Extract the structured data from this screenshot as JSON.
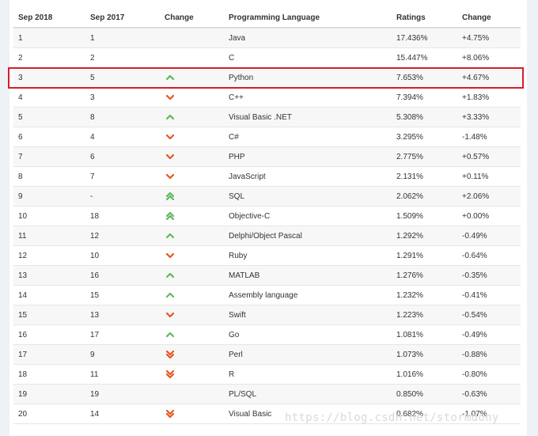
{
  "table": {
    "headers": [
      "Sep 2018",
      "Sep 2017",
      "Change",
      "Programming Language",
      "Ratings",
      "Change"
    ],
    "rows": [
      {
        "cur": "1",
        "prev": "1",
        "trend": "none",
        "lang": "Java",
        "rating": "17.436%",
        "change": "+4.75%"
      },
      {
        "cur": "2",
        "prev": "2",
        "trend": "none",
        "lang": "C",
        "rating": "15.447%",
        "change": "+8.06%"
      },
      {
        "cur": "3",
        "prev": "5",
        "trend": "up",
        "lang": "Python",
        "rating": "7.653%",
        "change": "+4.67%"
      },
      {
        "cur": "4",
        "prev": "3",
        "trend": "down",
        "lang": "C++",
        "rating": "7.394%",
        "change": "+1.83%"
      },
      {
        "cur": "5",
        "prev": "8",
        "trend": "up",
        "lang": "Visual Basic .NET",
        "rating": "5.308%",
        "change": "+3.33%"
      },
      {
        "cur": "6",
        "prev": "4",
        "trend": "down",
        "lang": "C#",
        "rating": "3.295%",
        "change": "-1.48%"
      },
      {
        "cur": "7",
        "prev": "6",
        "trend": "down",
        "lang": "PHP",
        "rating": "2.775%",
        "change": "+0.57%"
      },
      {
        "cur": "8",
        "prev": "7",
        "trend": "down",
        "lang": "JavaScript",
        "rating": "2.131%",
        "change": "+0.11%"
      },
      {
        "cur": "9",
        "prev": "-",
        "trend": "up2",
        "lang": "SQL",
        "rating": "2.062%",
        "change": "+2.06%"
      },
      {
        "cur": "10",
        "prev": "18",
        "trend": "up2",
        "lang": "Objective-C",
        "rating": "1.509%",
        "change": "+0.00%"
      },
      {
        "cur": "11",
        "prev": "12",
        "trend": "up",
        "lang": "Delphi/Object Pascal",
        "rating": "1.292%",
        "change": "-0.49%"
      },
      {
        "cur": "12",
        "prev": "10",
        "trend": "down",
        "lang": "Ruby",
        "rating": "1.291%",
        "change": "-0.64%"
      },
      {
        "cur": "13",
        "prev": "16",
        "trend": "up",
        "lang": "MATLAB",
        "rating": "1.276%",
        "change": "-0.35%"
      },
      {
        "cur": "14",
        "prev": "15",
        "trend": "up",
        "lang": "Assembly language",
        "rating": "1.232%",
        "change": "-0.41%"
      },
      {
        "cur": "15",
        "prev": "13",
        "trend": "down",
        "lang": "Swift",
        "rating": "1.223%",
        "change": "-0.54%"
      },
      {
        "cur": "16",
        "prev": "17",
        "trend": "up",
        "lang": "Go",
        "rating": "1.081%",
        "change": "-0.49%"
      },
      {
        "cur": "17",
        "prev": "9",
        "trend": "down2",
        "lang": "Perl",
        "rating": "1.073%",
        "change": "-0.88%"
      },
      {
        "cur": "18",
        "prev": "11",
        "trend": "down2",
        "lang": "R",
        "rating": "1.016%",
        "change": "-0.80%"
      },
      {
        "cur": "19",
        "prev": "19",
        "trend": "none",
        "lang": "PL/SQL",
        "rating": "0.850%",
        "change": "-0.63%"
      },
      {
        "cur": "20",
        "prev": "14",
        "trend": "down2",
        "lang": "Visual Basic",
        "rating": "0.682%",
        "change": "-1.07%"
      }
    ]
  },
  "colors": {
    "up": "#5cb85c",
    "down": "#e8541e",
    "highlight": "#d32027"
  },
  "icons": {
    "up": "chevron-up-icon",
    "up2": "double-chevron-up-icon",
    "down": "chevron-down-icon",
    "down2": "double-chevron-down-icon"
  },
  "watermark": "https://blog.csdn.net/stormdony"
}
